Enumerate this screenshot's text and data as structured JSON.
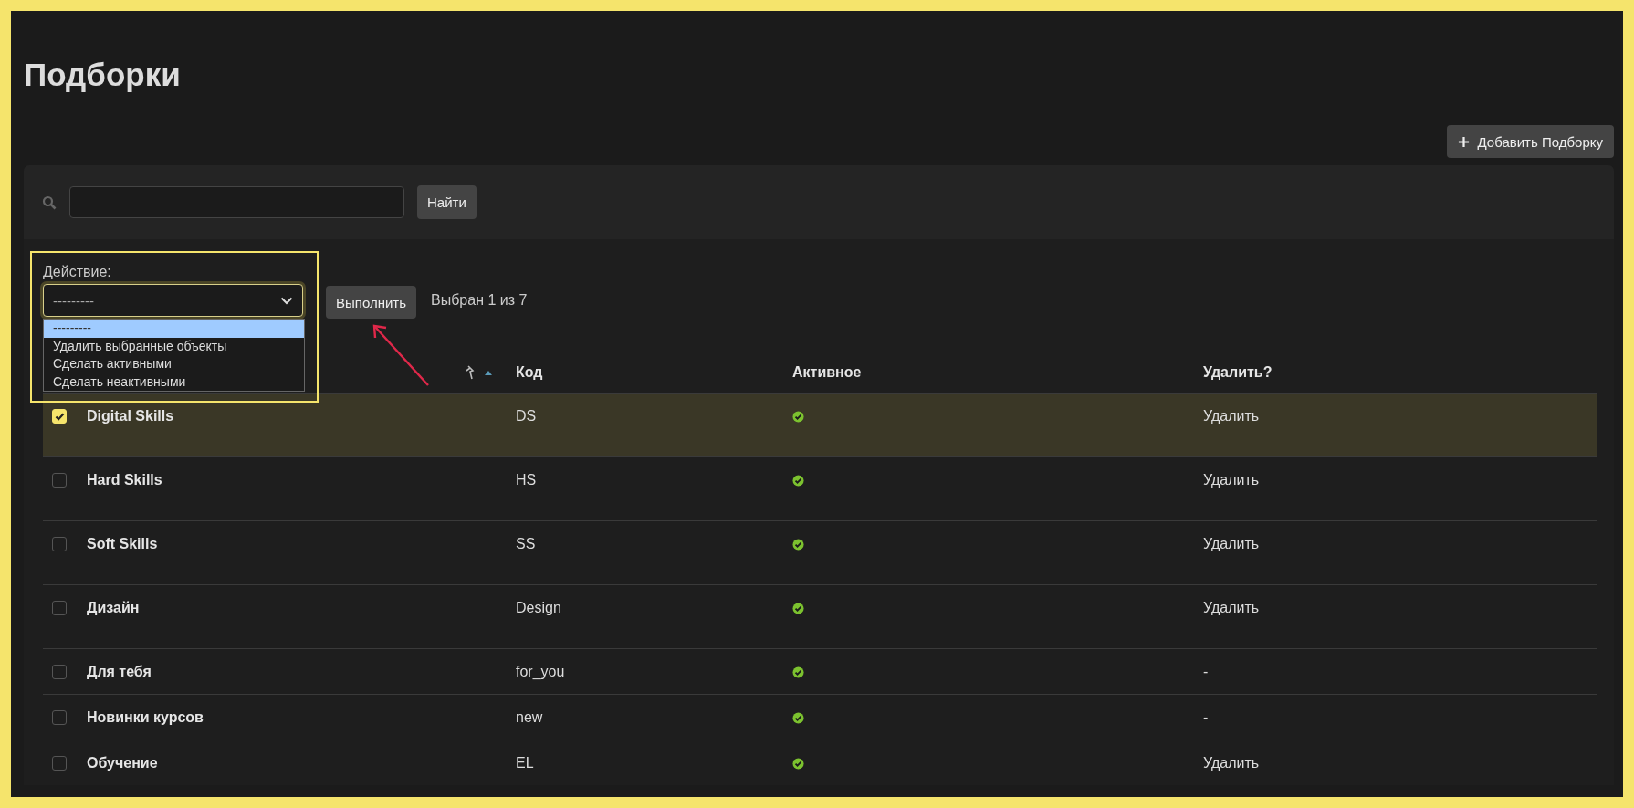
{
  "title": "Подборки",
  "add_button": {
    "label": "Добавить Подборку"
  },
  "search": {
    "button": "Найти"
  },
  "action": {
    "label": "Действие:",
    "value": "---------",
    "expanded": true,
    "options": [
      {
        "label": "---------",
        "selected": true
      },
      {
        "label": "Удалить выбранные объекты",
        "selected": false
      },
      {
        "label": "Сделать активными",
        "selected": false
      },
      {
        "label": "Сделать неактивными",
        "selected": false
      }
    ],
    "run_button": "Выполнить",
    "selection_count": "Выбран 1 из 7"
  },
  "annotations": {
    "highlight_box": true,
    "arrow": true
  },
  "table": {
    "column_1": {
      "sorted_ascending": true
    },
    "columns": [
      "Код",
      "Активное",
      "Удалить?"
    ],
    "rows": [
      {
        "name": "Digital Skills",
        "code": "DS",
        "active": true,
        "delete": "Удалить",
        "selected": true
      },
      {
        "name": "Hard Skills",
        "code": "HS",
        "active": true,
        "delete": "Удалить",
        "selected": false
      },
      {
        "name": "Soft Skills",
        "code": "SS",
        "active": true,
        "delete": "Удалить",
        "selected": false
      },
      {
        "name": "Дизайн",
        "code": "Design",
        "active": true,
        "delete": "Удалить",
        "selected": false
      },
      {
        "name": "Для тебя",
        "code": "for_you",
        "active": true,
        "delete": "-",
        "selected": false
      },
      {
        "name": "Новинки курсов",
        "code": "new",
        "active": true,
        "delete": "-",
        "selected": false
      },
      {
        "name": "Обучение",
        "code": "EL",
        "active": true,
        "delete": "Удалить",
        "selected": false
      }
    ]
  }
}
